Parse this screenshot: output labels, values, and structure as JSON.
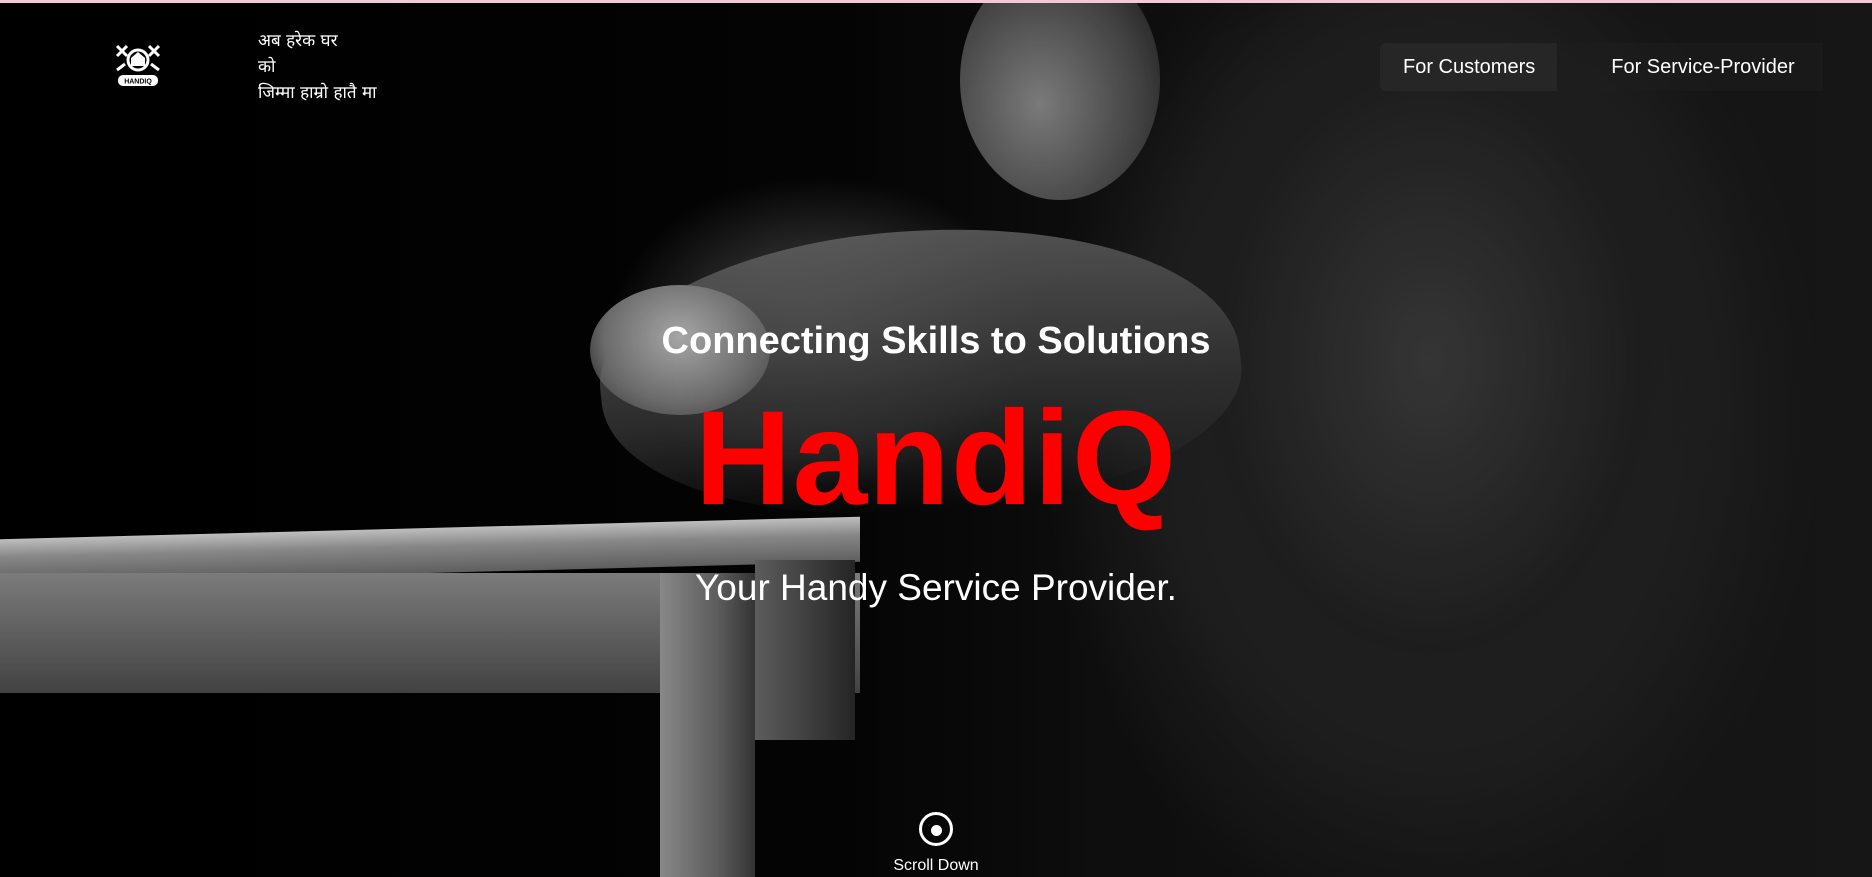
{
  "header": {
    "logo": {
      "text": "HANDIQ",
      "icon": "handiq-logo-icon"
    },
    "tagline_lines": [
      "अब हरेक घर",
      "को",
      "जिम्मा हाम्रो हातै मा"
    ]
  },
  "nav": {
    "customers_label": "For Customers",
    "providers_label": "For Service-Provider"
  },
  "hero": {
    "headline": "Connecting Skills to Solutions",
    "brand": "HandiQ",
    "tagline": "Your Handy Service Provider.",
    "brand_color": "#ff0000"
  },
  "scroll": {
    "label": "Scroll Down",
    "icon": "scroll-down-icon"
  },
  "colors": {
    "accent": "#ff0000",
    "text": "#ffffff",
    "background": "#000000",
    "top_border": "#f2c9d6"
  }
}
